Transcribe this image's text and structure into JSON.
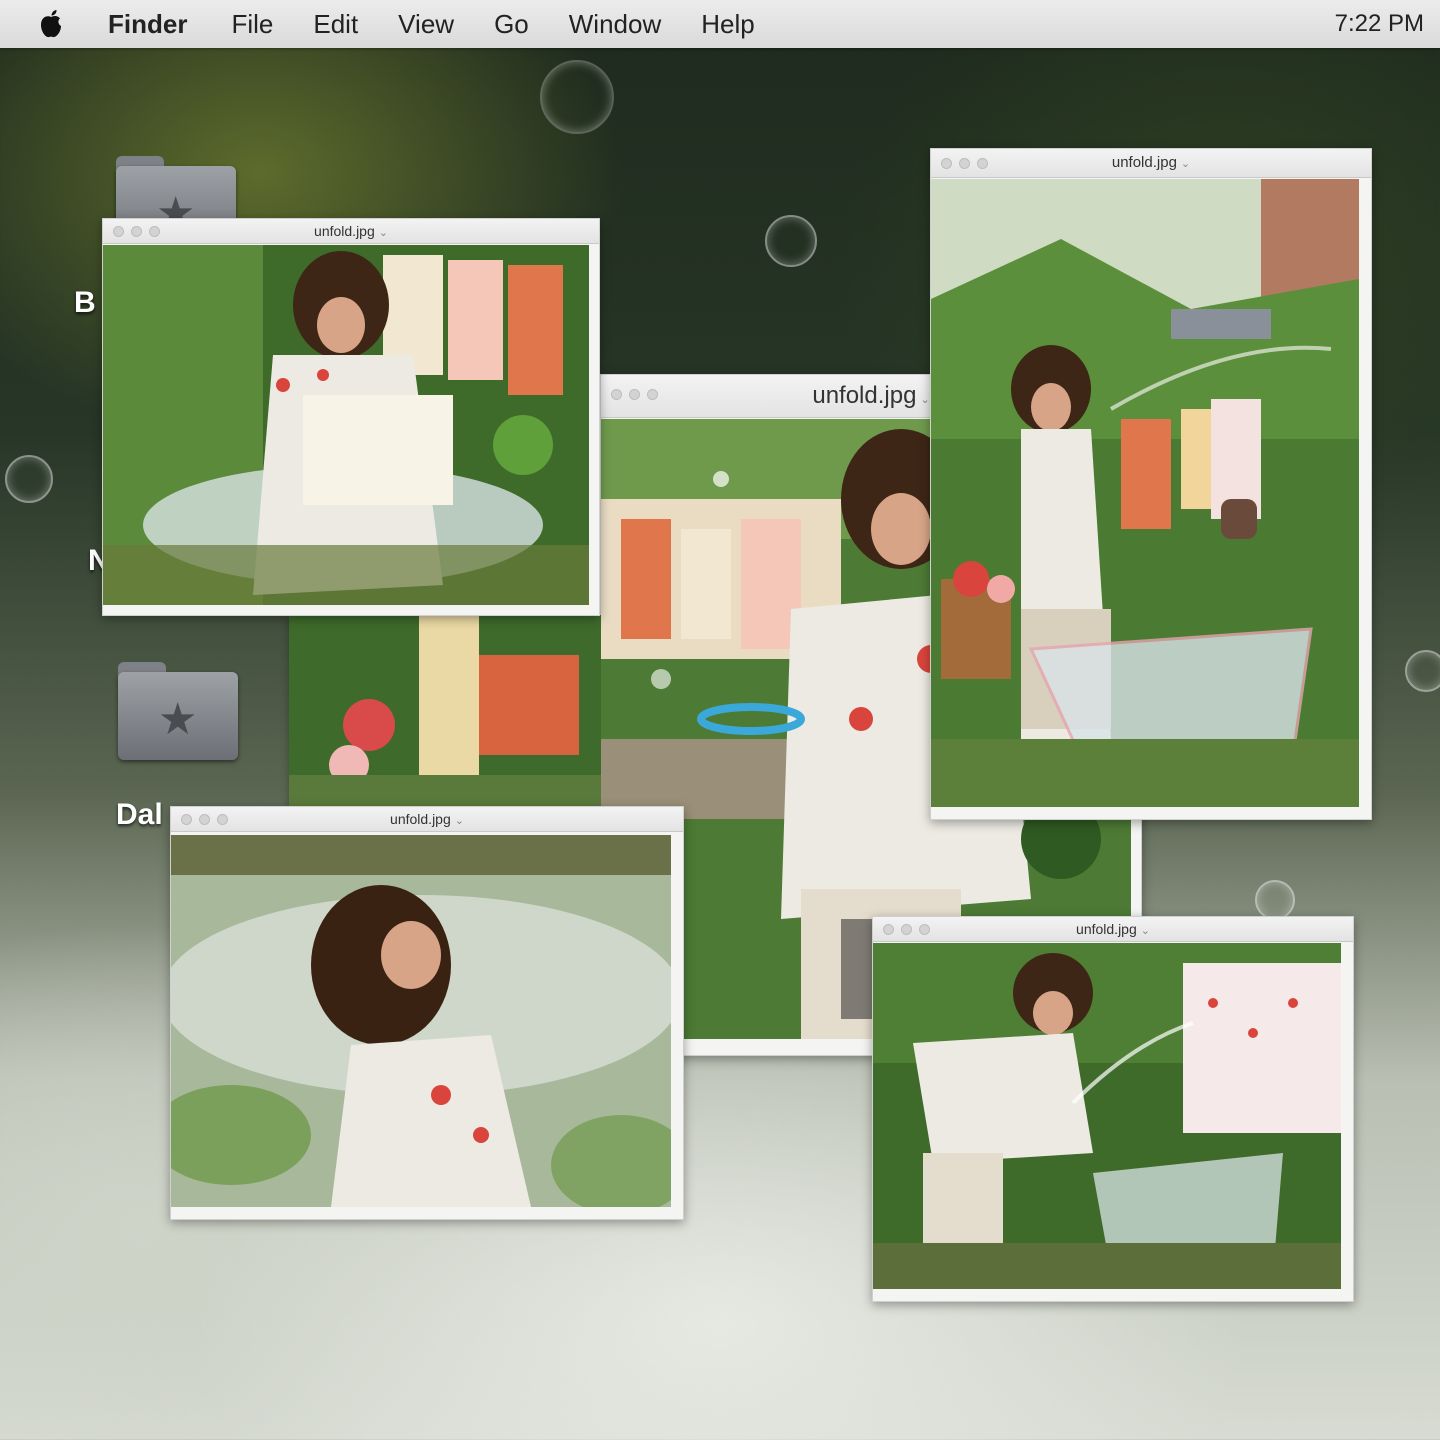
{
  "menubar": {
    "apple_icon": "apple-logo-icon",
    "app_name": "Finder",
    "items": [
      "File",
      "Edit",
      "View",
      "Go",
      "Window",
      "Help"
    ],
    "clock": "7:22 PM"
  },
  "desktop": {
    "folders": [
      {
        "label": "B",
        "icon": "starred-folder-icon"
      },
      {
        "label": "N",
        "icon": "starred-folder-icon"
      },
      {
        "label": "Dal",
        "icon": "starred-folder-icon"
      }
    ]
  },
  "windows": [
    {
      "id": "center",
      "title": "unfold.jpg",
      "image": "person-with-bubble-wand-garden-photo"
    },
    {
      "id": "topleft",
      "title": "unfold.jpg",
      "image": "person-holding-white-cloth-garden-photo"
    },
    {
      "id": "right",
      "title": "unfold.jpg",
      "image": "person-spraying-hose-over-tub-photo"
    },
    {
      "id": "botleft",
      "title": "unfold.jpg",
      "image": "person-face-up-sunlight-photo"
    },
    {
      "id": "botright",
      "title": "unfold.jpg",
      "image": "person-watering-clear-tub-photo"
    }
  ],
  "colors": {
    "menubar_bg": "#e4e4e4",
    "window_bg": "#f4f4f2",
    "foliage": "#3f6b2a",
    "shirt": "#eceae2"
  }
}
